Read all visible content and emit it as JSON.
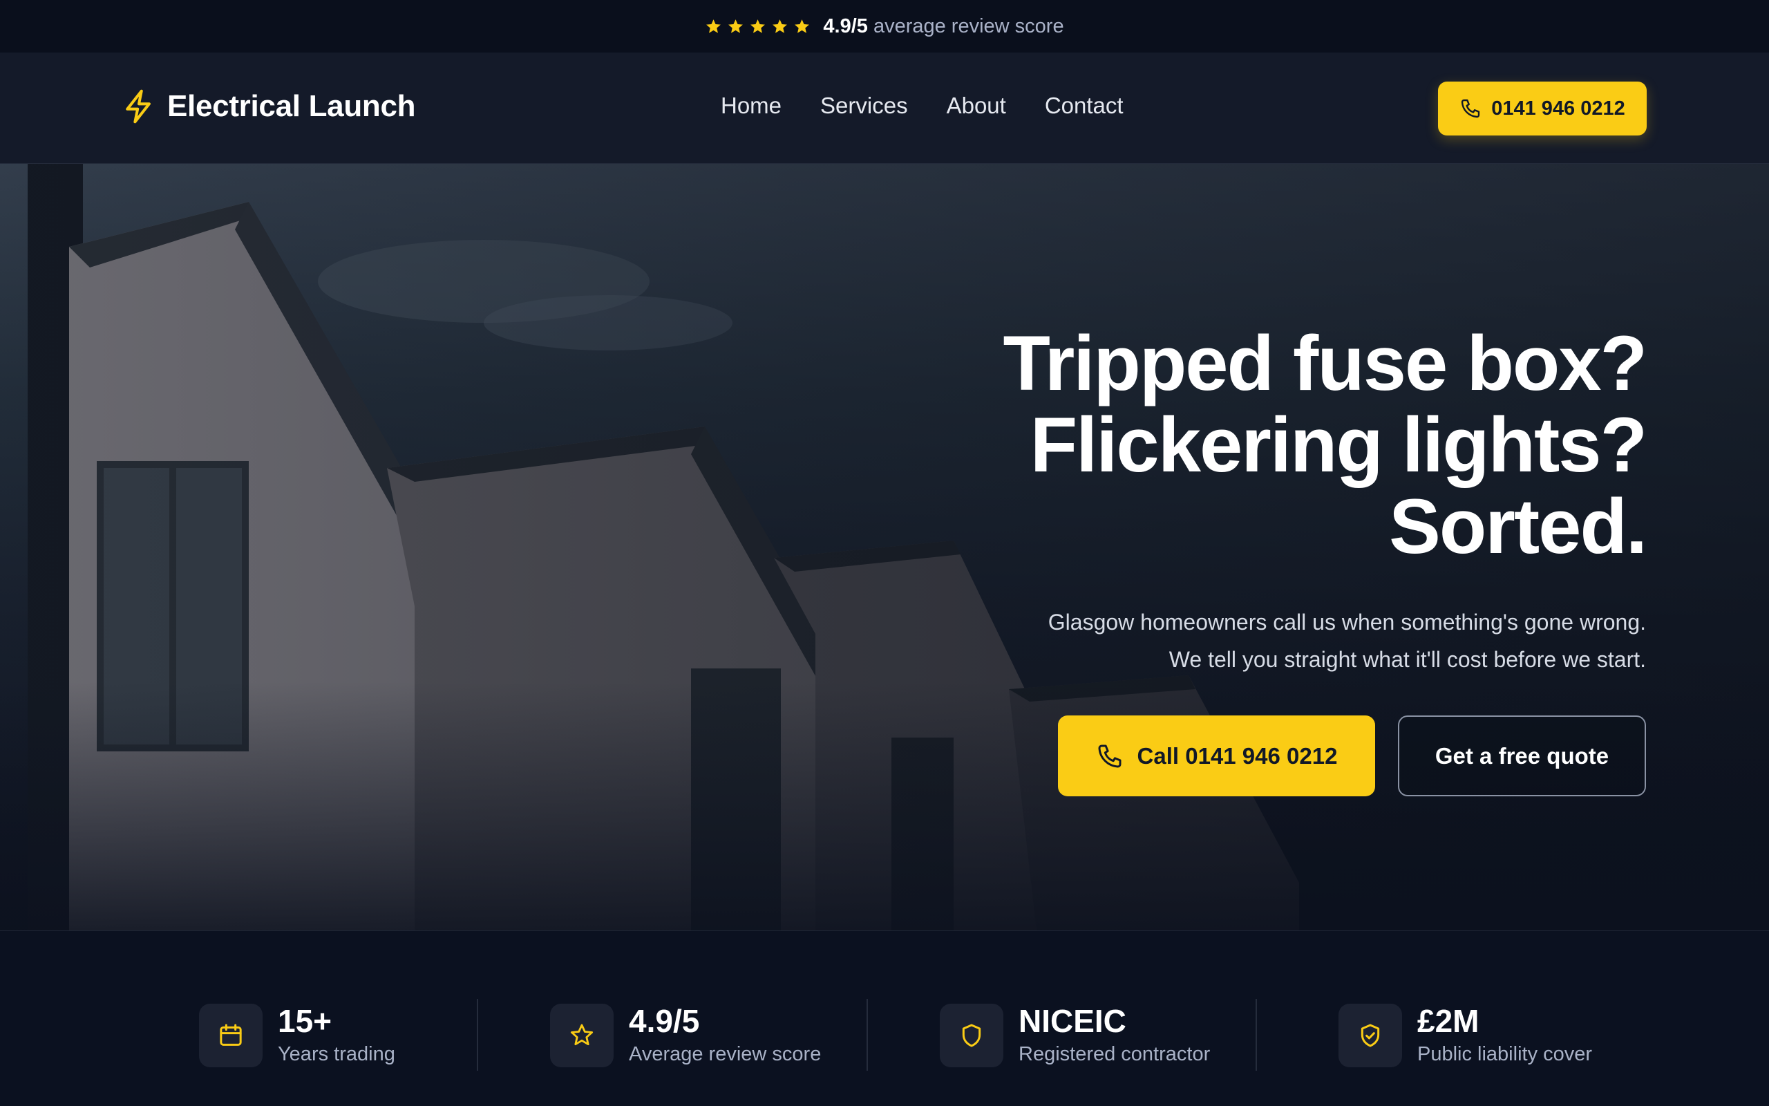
{
  "colors": {
    "accent": "#facc15",
    "background": "#0b1120",
    "header": "#141a29",
    "muted_text": "#a9b2c7"
  },
  "rating_bar": {
    "stars": 5,
    "score": "4.9/5",
    "text": "average review score",
    "icon": "star-icon"
  },
  "header": {
    "logo_icon": "lightning-bolt-icon",
    "logo_text": "Electrical Launch",
    "nav": [
      {
        "label": "Home"
      },
      {
        "label": "Services"
      },
      {
        "label": "About"
      },
      {
        "label": "Contact"
      }
    ],
    "cta": {
      "icon": "phone-icon",
      "label": "0141 946 0212"
    }
  },
  "hero": {
    "title_lines": [
      "Tripped fuse box?",
      "Flickering lights?",
      "Sorted."
    ],
    "subtitle": "Glasgow homeowners call us when something's gone wrong. We tell you straight what it'll cost before we start.",
    "primary_button": {
      "icon": "phone-icon",
      "label": "Call 0141 946 0212"
    },
    "secondary_button": {
      "label": "Get a free quote"
    }
  },
  "stats": [
    {
      "icon": "calendar-icon",
      "value": "15+",
      "label": "Years trading"
    },
    {
      "icon": "star-icon",
      "value": "4.9/5",
      "label": "Average review score"
    },
    {
      "icon": "shield-icon",
      "value": "NICEIC",
      "label": "Registered contractor"
    },
    {
      "icon": "shield-check-icon",
      "value": "£2M",
      "label": "Public liability cover"
    }
  ]
}
